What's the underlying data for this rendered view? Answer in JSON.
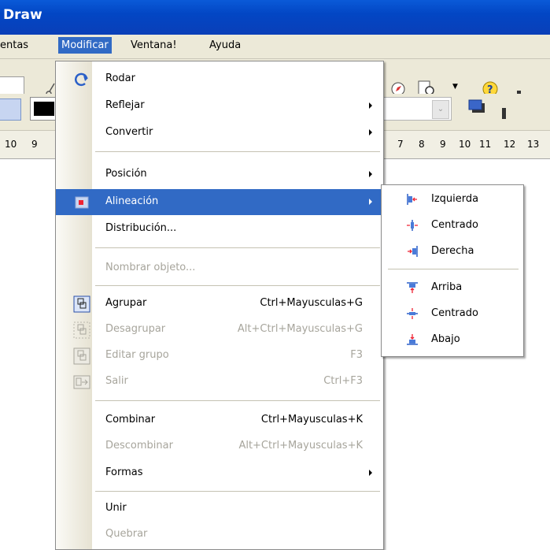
{
  "window": {
    "title": "Draw"
  },
  "menubar": {
    "items": [
      "entas",
      "Modificar",
      "Ventana!",
      "Ayuda"
    ]
  },
  "ruler": {
    "left": [
      "10",
      "9"
    ],
    "right": [
      "7",
      "8",
      "9",
      "10",
      "11",
      "12",
      "13"
    ]
  },
  "menu": {
    "items": [
      {
        "label": "Rodar",
        "shortcut": "",
        "submenu": false,
        "disabled": false,
        "icon": "rotate-icon"
      },
      {
        "label": "Reflejar",
        "shortcut": "",
        "submenu": true,
        "disabled": false
      },
      {
        "label": "Convertir",
        "shortcut": "",
        "submenu": true,
        "disabled": false
      },
      {
        "label": "Posición",
        "shortcut": "",
        "submenu": true,
        "disabled": false
      },
      {
        "label": "Alineación",
        "shortcut": "",
        "submenu": true,
        "disabled": false,
        "highlighted": true,
        "icon": "align-icon"
      },
      {
        "label": "Distribución...",
        "shortcut": "",
        "submenu": false,
        "disabled": false
      },
      {
        "label": "Nombrar objeto...",
        "shortcut": "",
        "submenu": false,
        "disabled": true
      },
      {
        "label": "Agrupar",
        "shortcut": "Ctrl+Mayusculas+G",
        "submenu": false,
        "disabled": false,
        "icon": "group-icon"
      },
      {
        "label": "Desagrupar",
        "shortcut": "Alt+Ctrl+Mayusculas+G",
        "submenu": false,
        "disabled": true,
        "icon": "ungroup-icon"
      },
      {
        "label": "Editar grupo",
        "shortcut": "F3",
        "submenu": false,
        "disabled": true,
        "icon": "edit-group-icon"
      },
      {
        "label": "Salir",
        "shortcut": "Ctrl+F3",
        "submenu": false,
        "disabled": true,
        "icon": "exit-group-icon"
      },
      {
        "label": "Combinar",
        "shortcut": "Ctrl+Mayusculas+K",
        "submenu": false,
        "disabled": false
      },
      {
        "label": "Descombinar",
        "shortcut": "Alt+Ctrl+Mayusculas+K",
        "submenu": false,
        "disabled": true
      },
      {
        "label": "Formas",
        "shortcut": "",
        "submenu": true,
        "disabled": false
      },
      {
        "label": "Unir",
        "shortcut": "",
        "submenu": false,
        "disabled": false
      },
      {
        "label": "Quebrar",
        "shortcut": "",
        "submenu": false,
        "disabled": true
      }
    ]
  },
  "submenu": {
    "items": [
      {
        "label": "Izquierda",
        "icon": "align-left-icon"
      },
      {
        "label": "Centrado",
        "icon": "align-center-horizontal-icon"
      },
      {
        "label": "Derecha",
        "icon": "align-right-icon"
      },
      {
        "label": "Arriba",
        "icon": "align-top-icon"
      },
      {
        "label": "Centrado",
        "icon": "align-center-vertical-icon"
      },
      {
        "label": "Abajo",
        "icon": "align-bottom-icon"
      }
    ]
  },
  "colors": {
    "accent": "#316ac5",
    "titlebar": "#0246c4",
    "chrome": "#ece9d8"
  }
}
